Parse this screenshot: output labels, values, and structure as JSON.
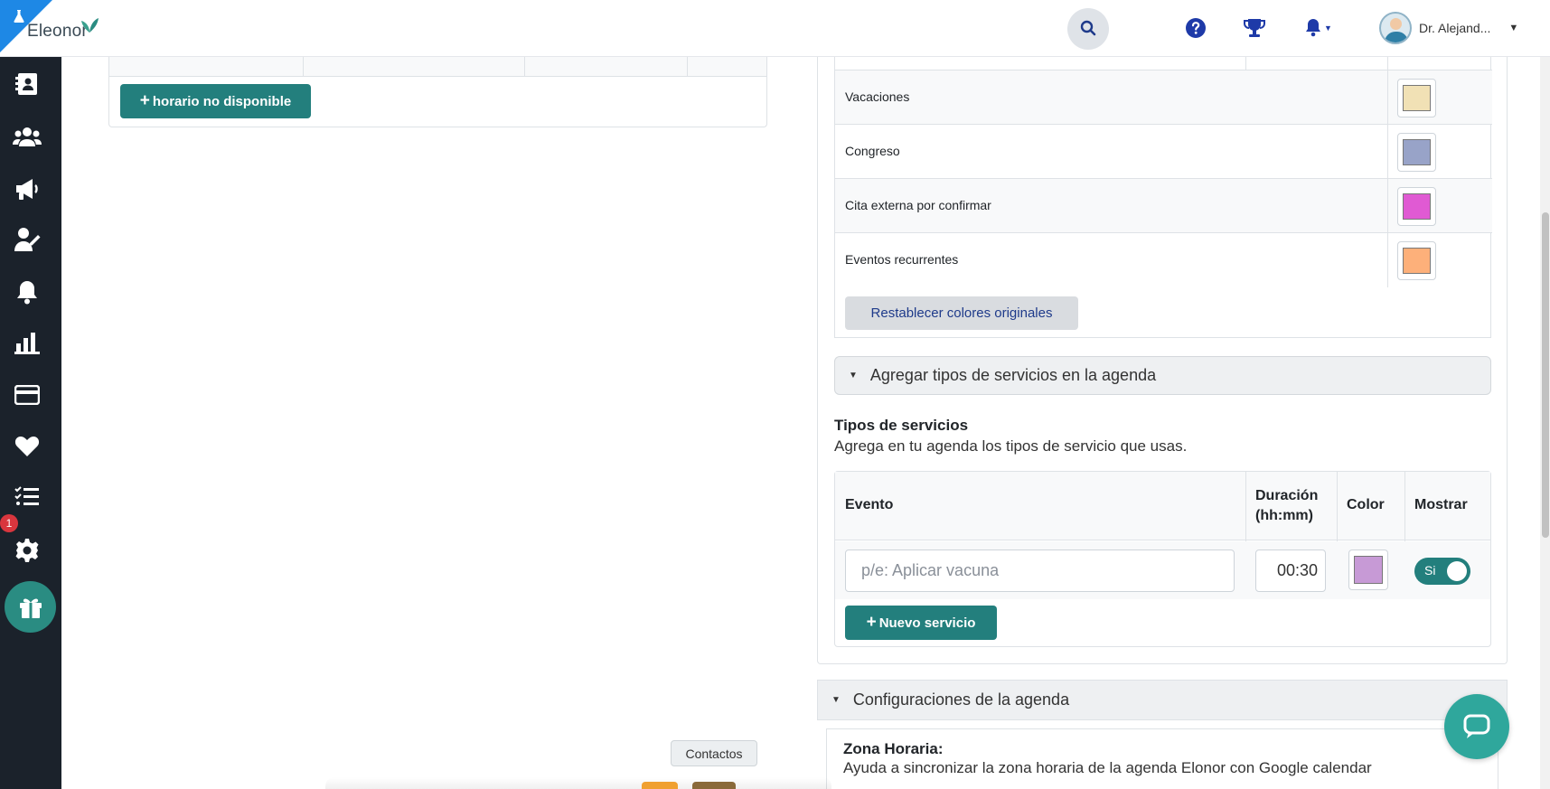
{
  "brand": {
    "name": "Eleonor"
  },
  "header": {
    "user_name": "Dr. Alejand...",
    "icons": [
      "search-icon",
      "help-icon",
      "trophy-icon",
      "bell-icon",
      "chevron-down-icon"
    ]
  },
  "sidebar": {
    "items": [
      "contacts-book-icon",
      "users-icon",
      "megaphone-icon",
      "doctor-icon",
      "bell-icon",
      "bar-chart-icon",
      "credit-card-icon",
      "heart-icon",
      "checklist-icon",
      "gear-icon",
      "gift-icon"
    ],
    "badge_count": "1",
    "accent": "#237f7d"
  },
  "left_panel": {
    "add_unavailable_label": "horario no disponible"
  },
  "event_colors": {
    "rows": [
      {
        "label": "Vacaciones",
        "color": "#f1e1b5"
      },
      {
        "label": "Congreso",
        "color": "#98a3c8"
      },
      {
        "label": "Cita externa por confirmar",
        "color": "#e05ad3"
      },
      {
        "label": "Eventos recurrentes",
        "color": "#fdb07a"
      }
    ],
    "reset_label": "Restablecer colores originales"
  },
  "services_accordion": {
    "title": "Agregar tipos de servicios en la agenda"
  },
  "services": {
    "title": "Tipos de servicios",
    "subtitle": "Agrega en tu agenda los tipos de servicio que usas.",
    "headers": {
      "event": "Evento",
      "duration": "Duración (hh:mm)",
      "color": "Color",
      "show": "Mostrar"
    },
    "row": {
      "event_placeholder": "p/e: Aplicar vacuna",
      "duration": "00:30",
      "color": "#c79ad6",
      "show_label": "Si"
    },
    "new_service_label": "Nuevo servicio"
  },
  "config_accordion": {
    "title": "Configuraciones de la agenda",
    "zone_title": "Zona Horaria:",
    "zone_subtitle": "Ayuda a sincronizar la zona horaria de la agenda Elonor con Google calendar"
  },
  "tooltip": {
    "text": "Contactos"
  }
}
